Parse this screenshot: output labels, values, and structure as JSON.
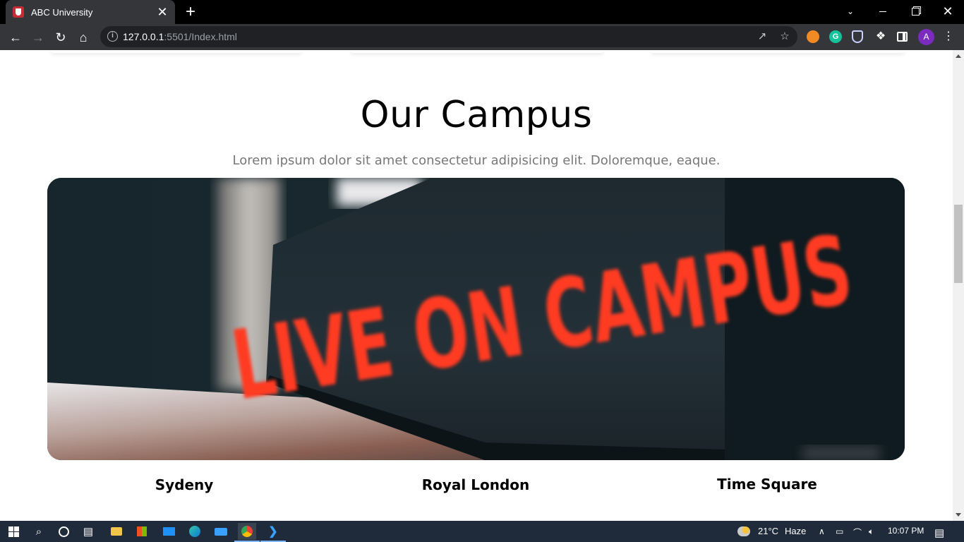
{
  "browser": {
    "tab_title": "ABC University",
    "tab_close": "✕",
    "new_tab": "+",
    "url_host": "127.0.0.1",
    "url_rest": ":5501/Index.html",
    "avatar_letter": "A",
    "grammarly_letter": "G"
  },
  "page": {
    "heading": "Our Campus",
    "subheading": "Lorem ipsum dolor sit amet consectetur adipisicing elit. Doloremque, eaque.",
    "image_sign_text": "LIVE ON CAMPUS",
    "campuses": [
      "Sydeny",
      "Royal London",
      "Time Square"
    ]
  },
  "taskbar": {
    "weather_temp": "21°C",
    "weather_desc": "Haze",
    "time": "10:07 PM"
  },
  "icons": {
    "back": "back-arrow-icon",
    "forward": "forward-arrow-icon",
    "reload": "reload-icon",
    "home": "home-icon",
    "share": "share-icon",
    "bookmark": "star-icon",
    "extensions": "puzzle-icon"
  },
  "colors": {
    "accent_red": "#ff3b22",
    "browser_dark": "#35363a",
    "taskbar": "#1f2b3a"
  }
}
